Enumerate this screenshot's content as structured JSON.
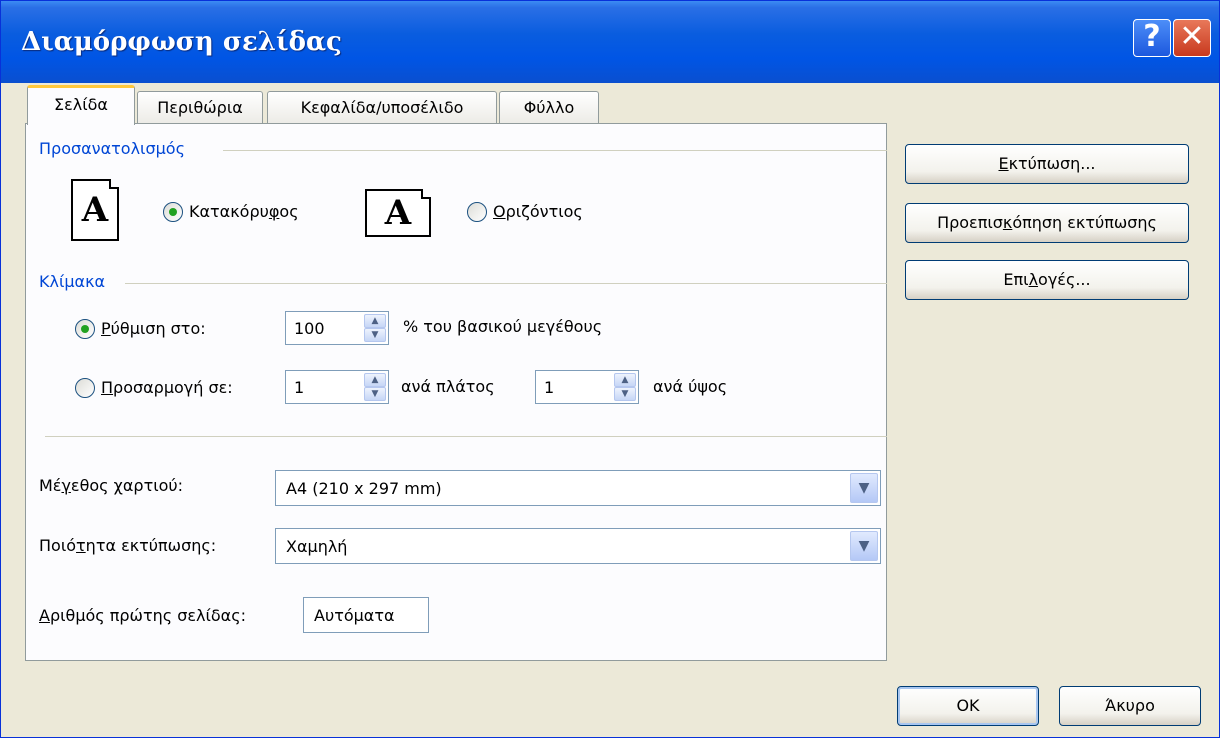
{
  "window": {
    "title": "Διαμόρφωση σελίδας",
    "help_label": "?",
    "close_label": "✕"
  },
  "tabs": [
    {
      "label": "Σελίδα",
      "active": true
    },
    {
      "label": "Περιθώρια",
      "active": false
    },
    {
      "label": "Κεφαλίδα/υποσέλιδο",
      "active": false
    },
    {
      "label": "Φύλλο",
      "active": false
    }
  ],
  "orientation": {
    "section_label": "Προσανατολισμός",
    "portrait_icon": "A",
    "portrait_label_a": "Κατακόρυ",
    "portrait_label_u": "φ",
    "portrait_label_b": "ος",
    "landscape_icon": "A",
    "landscape_label_u": "Ο",
    "landscape_label_b": "ριζόντιος",
    "selected": "portrait"
  },
  "scale": {
    "section_label": "Κλίμακα",
    "adjust_u": "Ρ",
    "adjust_rest": "ύθμιση στο:",
    "adjust_value": "100",
    "adjust_suffix": "% του βασικού μεγέθους",
    "fit_u": "Π",
    "fit_rest": "ροσαρμογή σε:",
    "fit_wide_value": "1",
    "fit_wide_label": "ανά πλάτος",
    "fit_tall_value": "1",
    "fit_tall_label": "ανά ύψος",
    "selected": "adjust"
  },
  "paper_size": {
    "label_a": "Μέ",
    "label_u": "γ",
    "label_b": "εθος χαρτιού:",
    "value": "A4 (210 x 297 mm)"
  },
  "print_quality": {
    "label_a": "Ποιό",
    "label_u": "τ",
    "label_b": "ητα εκτύπωσης:",
    "value": "Χαμηλή"
  },
  "first_page": {
    "label_u": "Α",
    "label_b": "ριθμός πρώτης σελίδας:",
    "value": "Αυτόματα"
  },
  "side_buttons": {
    "print_u": "Ε",
    "print_rest": "κτύπωση...",
    "preview_a": "Προεπισ",
    "preview_u": "κ",
    "preview_b": "όπηση εκτύπωσης",
    "options_a": "Επι",
    "options_u": "λ",
    "options_b": "ογές..."
  },
  "footer": {
    "ok_label": "OK",
    "cancel_label": "Άκυρο"
  }
}
